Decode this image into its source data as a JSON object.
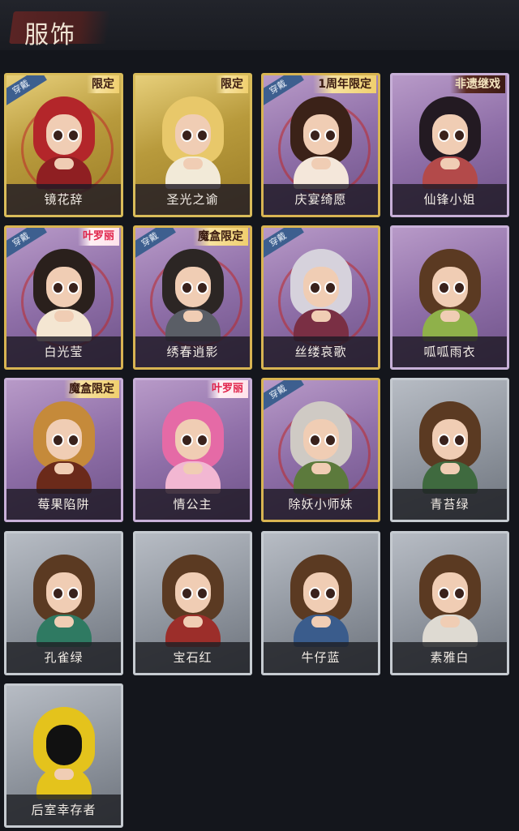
{
  "header": {
    "title": "服饰"
  },
  "tags": {
    "equipped": "穿戴"
  },
  "cards": [
    {
      "name": "镜花辞",
      "theme": "gold",
      "equipped": true,
      "limit": "限定",
      "limit_style": "light",
      "hair": "#b3262a",
      "outfit": "#8f1f22"
    },
    {
      "name": "圣光之谕",
      "theme": "gold",
      "equipped": false,
      "limit": "限定",
      "limit_style": "light",
      "hair": "#e8c86a",
      "outfit": "#f2ead8"
    },
    {
      "name": "庆宴绮愿",
      "theme": "purple",
      "equipped": true,
      "limit": "1周年限定",
      "limit_style": "light",
      "hair": "#3b2218",
      "outfit": "#f4e7da"
    },
    {
      "name": "仙锋小姐",
      "theme": "purple",
      "equipped": false,
      "limit": "非遗继戏",
      "limit_style": "dark",
      "hair": "#231a22",
      "outfit": "#b34a4a"
    },
    {
      "name": "白光莹",
      "theme": "purple",
      "equipped": true,
      "limit": "叶罗丽",
      "limit_style": "lolita",
      "hair": "#2a201c",
      "outfit": "#f4e6d2"
    },
    {
      "name": "绣春逍影",
      "theme": "purple",
      "equipped": true,
      "limit": "魔盒限定",
      "limit_style": "light",
      "hair": "#2c2624",
      "outfit": "#5a5e66"
    },
    {
      "name": "丝缕哀歌",
      "theme": "purple",
      "equipped": true,
      "limit": "",
      "limit_style": "",
      "hair": "#d6d2dc",
      "outfit": "#7a2f44"
    },
    {
      "name": "呱呱雨衣",
      "theme": "purple",
      "equipped": false,
      "limit": "",
      "limit_style": "",
      "hair": "#5b3a22",
      "outfit": "#8fb14a"
    },
    {
      "name": "莓果陷阱",
      "theme": "purple",
      "equipped": false,
      "limit": "魔盒限定",
      "limit_style": "light",
      "hair": "#c58a3a",
      "outfit": "#6b2a1a"
    },
    {
      "name": "情公主",
      "theme": "purple",
      "equipped": false,
      "limit": "叶罗丽",
      "limit_style": "lolita",
      "hair": "#e56aa6",
      "outfit": "#f2b7d2"
    },
    {
      "name": "除妖小师妹",
      "theme": "purple",
      "equipped": true,
      "limit": "",
      "limit_style": "",
      "hair": "#cfcac4",
      "outfit": "#5c7a3c"
    },
    {
      "name": "青苔绿",
      "theme": "grey",
      "equipped": false,
      "limit": "",
      "limit_style": "",
      "hair": "#5b3a22",
      "outfit": "#3f6a3f"
    },
    {
      "name": "孔雀绿",
      "theme": "grey",
      "equipped": false,
      "limit": "",
      "limit_style": "",
      "hair": "#5b3a22",
      "outfit": "#2f7a62"
    },
    {
      "name": "宝石红",
      "theme": "grey",
      "equipped": false,
      "limit": "",
      "limit_style": "",
      "hair": "#5b3a22",
      "outfit": "#9c2e2a"
    },
    {
      "name": "牛仔蓝",
      "theme": "grey",
      "equipped": false,
      "limit": "",
      "limit_style": "",
      "hair": "#5b3a22",
      "outfit": "#3a5c8c"
    },
    {
      "name": "素雅白",
      "theme": "grey",
      "equipped": false,
      "limit": "",
      "limit_style": "",
      "hair": "#5b3a22",
      "outfit": "#dedad2"
    },
    {
      "name": "后室幸存者",
      "theme": "grey",
      "equipped": false,
      "limit": "",
      "limit_style": "",
      "hair": "#e4c31c",
      "outfit": "#e4c31c",
      "mask": true
    }
  ]
}
